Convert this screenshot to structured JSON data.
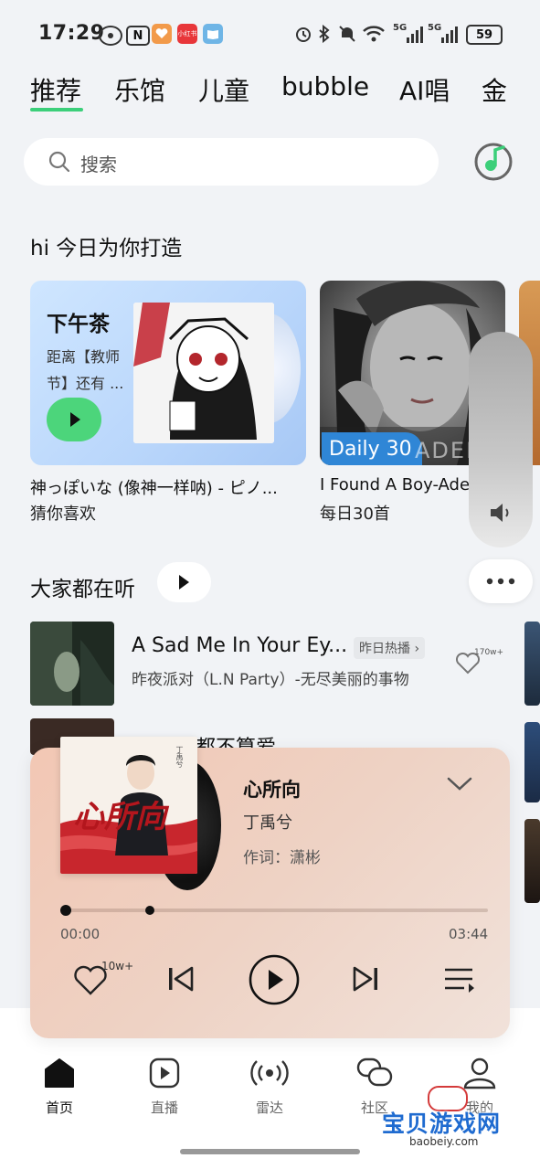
{
  "status_bar": {
    "time": "17:29",
    "app_icons": [
      "location-icon",
      "n-icon",
      "heart-app-icon",
      "xiaohongshu-icon",
      "book-app-icon"
    ],
    "xiaohongshu_label": "小红书",
    "network_1": "5G",
    "network_2": "5G",
    "battery": "59"
  },
  "tabs": [
    {
      "label": "推荐",
      "active": true
    },
    {
      "label": "乐馆",
      "active": false
    },
    {
      "label": "儿童",
      "active": false
    },
    {
      "label": "bubble",
      "active": false
    },
    {
      "label": "AI唱",
      "active": false
    },
    {
      "label": "金",
      "active": false
    }
  ],
  "search": {
    "placeholder": "搜索"
  },
  "section_daily": {
    "title": "hi 今日为你打造",
    "cards": [
      {
        "heading": "下午茶",
        "desc_line1": "距离【教师",
        "desc_line2": "节】还有 ...",
        "caption": "神っぽいな (像神一样呐) - ピノ...",
        "sub": "猜你喜欢"
      },
      {
        "badge": "Daily 30",
        "cover_text": "ADELE",
        "caption": "I Found A Boy-Ade",
        "sub": "每日30首"
      }
    ]
  },
  "section_popular": {
    "title": "大家都在听",
    "items": [
      {
        "title": "A Sad Me In Your Ey...",
        "tag": "昨日热播",
        "artist": "昨夜派对（L.N Party）-无尽美丽的事物",
        "likes": "170w+"
      },
      {
        "title": "都不算爱"
      }
    ]
  },
  "player": {
    "title": "心所向",
    "artist": "丁禹兮",
    "lyricist": "作词：潇彬",
    "cover_title": "心所向",
    "cover_subtitle": "丁禹兮",
    "current_time": "00:00",
    "total_time": "03:44",
    "progress": 0.0,
    "likes": "10w+"
  },
  "bottom_nav": [
    {
      "label": "首页",
      "icon": "home-icon",
      "active": true
    },
    {
      "label": "直播",
      "icon": "live-icon",
      "active": false
    },
    {
      "label": "雷达",
      "icon": "radar-icon",
      "active": false
    },
    {
      "label": "社区",
      "icon": "community-icon",
      "active": false
    },
    {
      "label": "我的",
      "icon": "profile-icon",
      "active": false
    }
  ],
  "watermark": {
    "text": "宝贝游戏网",
    "url": "baobeiy.com"
  },
  "colors": {
    "accent": "#3ccf7a",
    "player_bg": "#f2c7b4",
    "play_green": "#4cd57b"
  }
}
